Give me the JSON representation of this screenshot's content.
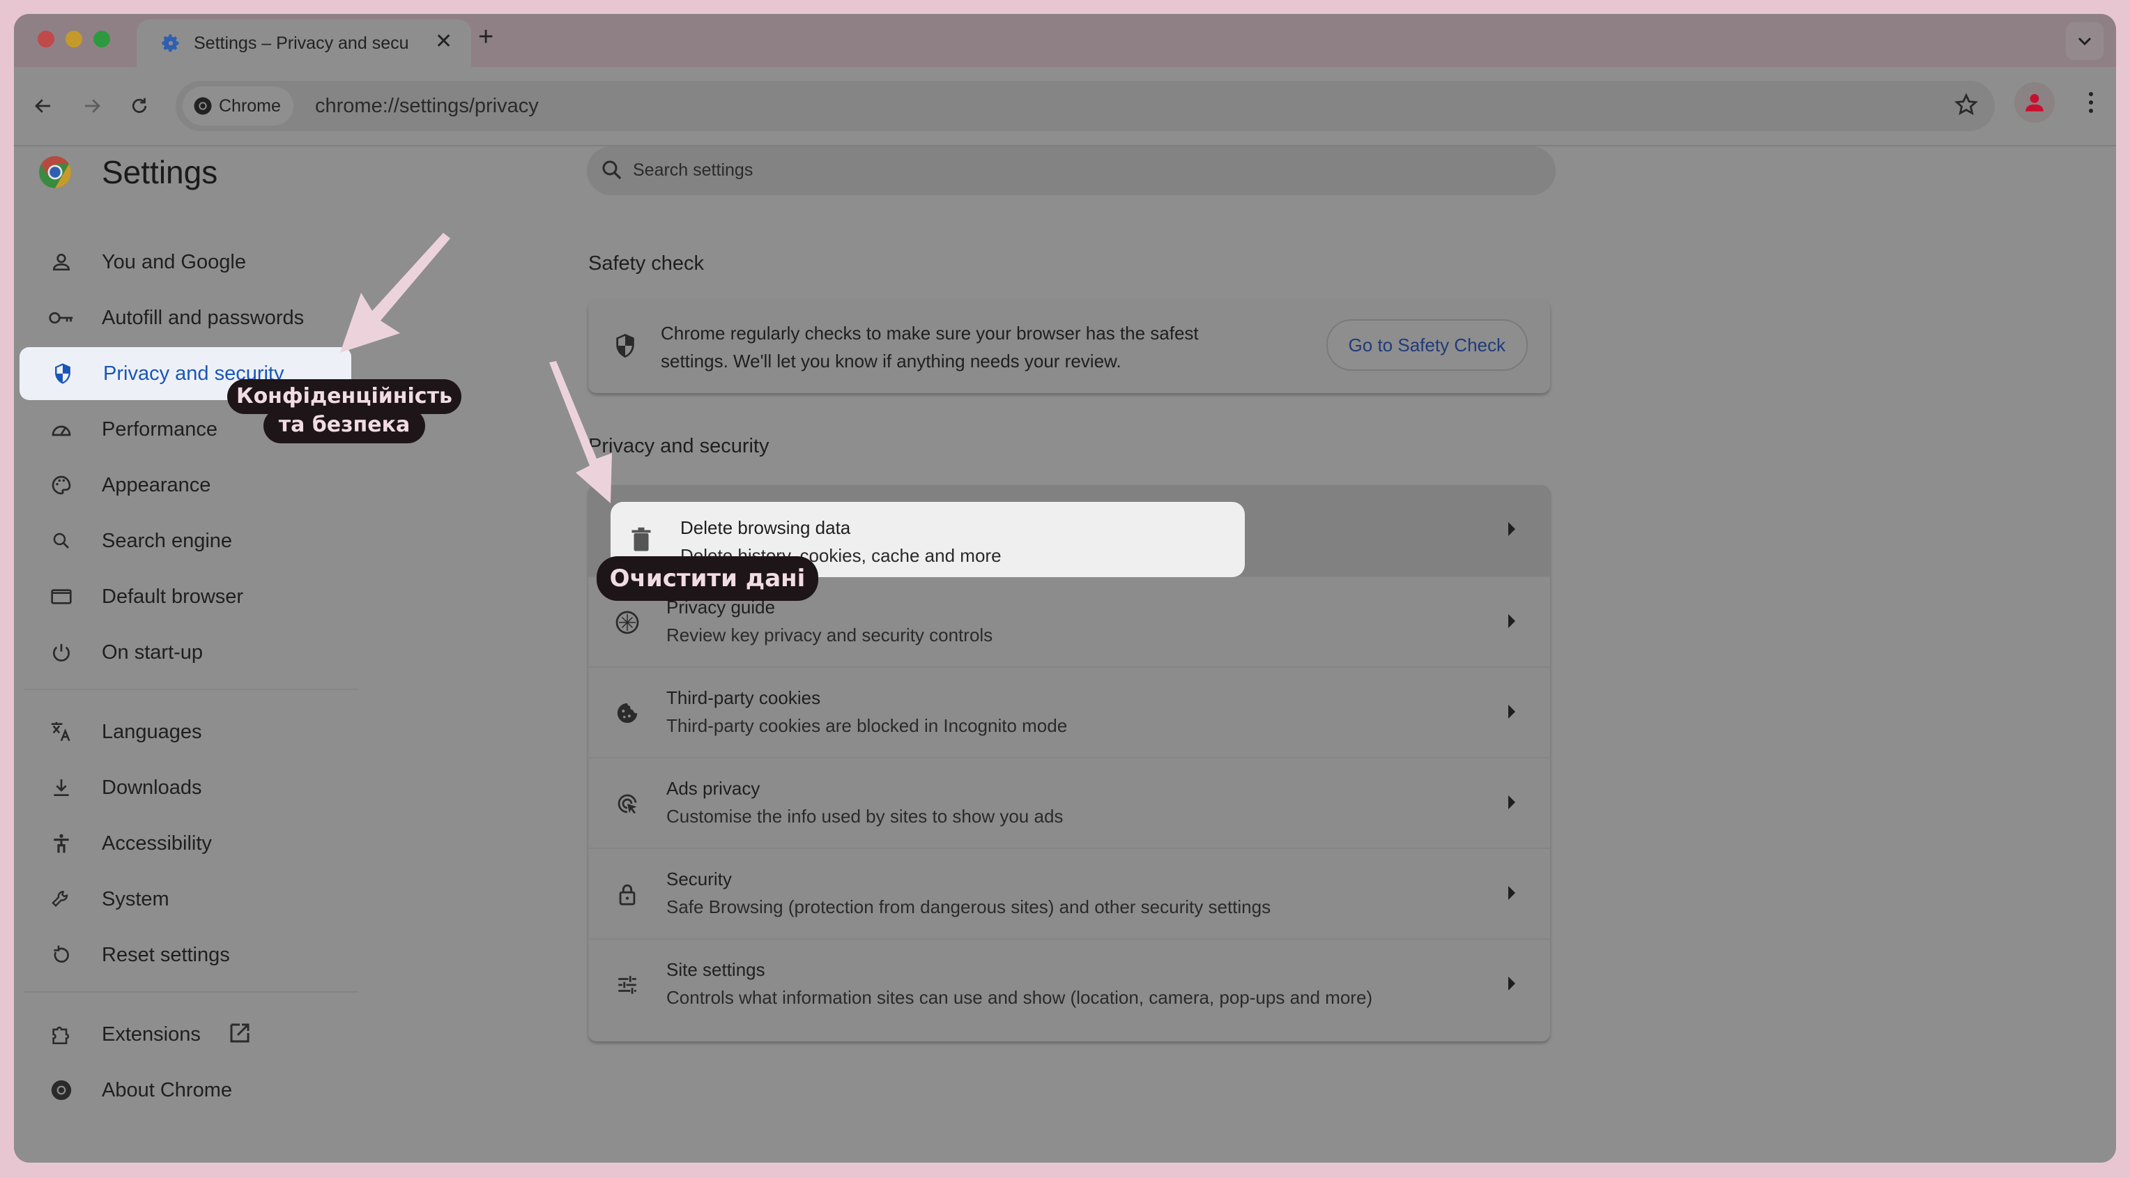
{
  "browser": {
    "tab_title": "Settings – Privacy and security",
    "new_tab_label": "+",
    "omnibox_chip": "Chrome",
    "url": "chrome://settings/privacy"
  },
  "settings": {
    "title": "Settings",
    "search_placeholder": "Search settings",
    "nav": [
      {
        "label": "You and Google",
        "icon": "person-icon"
      },
      {
        "label": "Autofill and passwords",
        "icon": "key-icon"
      },
      {
        "label": "Privacy and security",
        "icon": "shield-icon",
        "active": true
      },
      {
        "label": "Performance",
        "icon": "speedometer-icon"
      },
      {
        "label": "Appearance",
        "icon": "palette-icon"
      },
      {
        "label": "Search engine",
        "icon": "search-icon"
      },
      {
        "label": "Default browser",
        "icon": "browser-window-icon"
      },
      {
        "label": "On start-up",
        "icon": "power-icon"
      },
      {
        "label": "Languages",
        "icon": "translate-icon"
      },
      {
        "label": "Downloads",
        "icon": "download-icon"
      },
      {
        "label": "Accessibility",
        "icon": "accessibility-icon"
      },
      {
        "label": "System",
        "icon": "wrench-icon"
      },
      {
        "label": "Reset settings",
        "icon": "reset-icon"
      },
      {
        "label": "Extensions",
        "icon": "puzzle-icon"
      },
      {
        "label": "About Chrome",
        "icon": "chrome-icon"
      }
    ],
    "safety_check": {
      "heading": "Safety check",
      "text": "Chrome regularly checks to make sure your browser has the safest settings. We'll let you know if anything needs your review.",
      "button": "Go to Safety Check"
    },
    "privacy": {
      "heading": "Privacy and security",
      "rows": [
        {
          "title": "Delete browsing data",
          "subtitle": "Delete history, cookies, cache and more",
          "icon": "trash-icon"
        },
        {
          "title": "Privacy guide",
          "subtitle": "Review key privacy and security controls",
          "icon": "compass-icon"
        },
        {
          "title": "Third-party cookies",
          "subtitle": "Third-party cookies are blocked in Incognito mode",
          "icon": "cookie-icon"
        },
        {
          "title": "Ads privacy",
          "subtitle": "Customise the info used by sites to show you ads",
          "icon": "ads-target-icon"
        },
        {
          "title": "Security",
          "subtitle": "Safe Browsing (protection from dangerous sites) and other security settings",
          "icon": "lock-icon"
        },
        {
          "title": "Site settings",
          "subtitle": "Controls what information sites can use and show (location, camera, pop-ups and more)",
          "icon": "sliders-icon"
        }
      ]
    }
  },
  "annotations": {
    "callout_privacy_line1": "Конфіденційність",
    "callout_privacy_line2": "та безпека",
    "callout_delete": "Очистити дані",
    "arrow_color": "#e8c6d1"
  }
}
